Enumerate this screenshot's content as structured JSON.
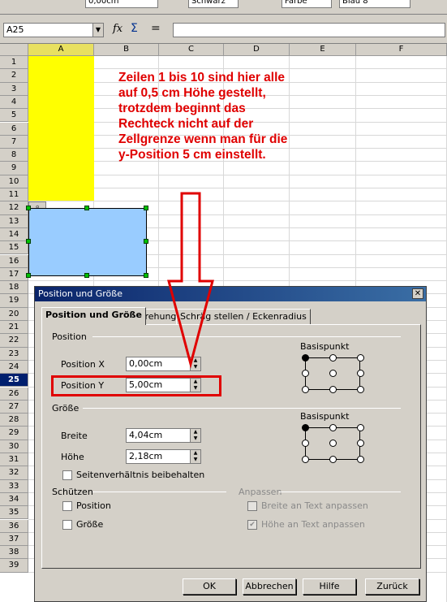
{
  "toolbar": {
    "font_size_value": "0,00cm",
    "line_color_value": "Schwarz",
    "area_style_value": "Farbe",
    "area_color_value": "Blau 8"
  },
  "formula_bar": {
    "cell_ref": "A25",
    "fx": "fx",
    "sigma": "Σ",
    "equals": "="
  },
  "sheet": {
    "columns": [
      "A",
      "B",
      "C",
      "D",
      "E",
      "F"
    ],
    "rows": [
      "1",
      "2",
      "3",
      "4",
      "5",
      "6",
      "7",
      "8",
      "9",
      "10",
      "11",
      "12",
      "13",
      "14",
      "15",
      "16",
      "17",
      "18",
      "19",
      "20",
      "21",
      "22",
      "23",
      "24",
      "25",
      "26",
      "27",
      "28",
      "29",
      "30",
      "31",
      "32",
      "33",
      "34",
      "35",
      "36",
      "37",
      "38",
      "39"
    ],
    "selected_row": "25",
    "selected_col": "A",
    "note": "Zeilen 1 bis 10 sind hier alle auf 0,5 cm Höhe gestellt, trotzdem beginnt das Rechteck nicht auf der Zellgrenze wenn man für die y-Position 5 cm einstellt.",
    "colors": {
      "highlight": "#ffff00",
      "rectangle": "#99ccff",
      "note": "#e00000"
    }
  },
  "dialog": {
    "title": "Position und Größe",
    "close": "✕",
    "tabs": [
      "Position und Größe",
      "Drehung",
      "Schräg stellen / Eckenradius"
    ],
    "position_section": "Position",
    "position_x_label": "Position X",
    "position_x_value": "0,00cm",
    "position_y_label": "Position Y",
    "position_y_value": "5,00cm",
    "basispunkt_label": "Basispunkt",
    "size_section": "Größe",
    "width_label": "Breite",
    "width_value": "4,04cm",
    "height_label": "Höhe",
    "height_value": "2,18cm",
    "keep_ratio_label": "Seitenverhältnis beibehalten",
    "protect_section": "Schützen",
    "protect_position_label": "Position",
    "protect_size_label": "Größe",
    "adapt_section": "Anpassen",
    "fit_width_label": "Breite an Text anpassen",
    "fit_height_label": "Höhe an Text anpassen",
    "buttons": {
      "ok": "OK",
      "cancel": "Abbrechen",
      "help": "Hilfe",
      "back": "Zurück"
    }
  }
}
